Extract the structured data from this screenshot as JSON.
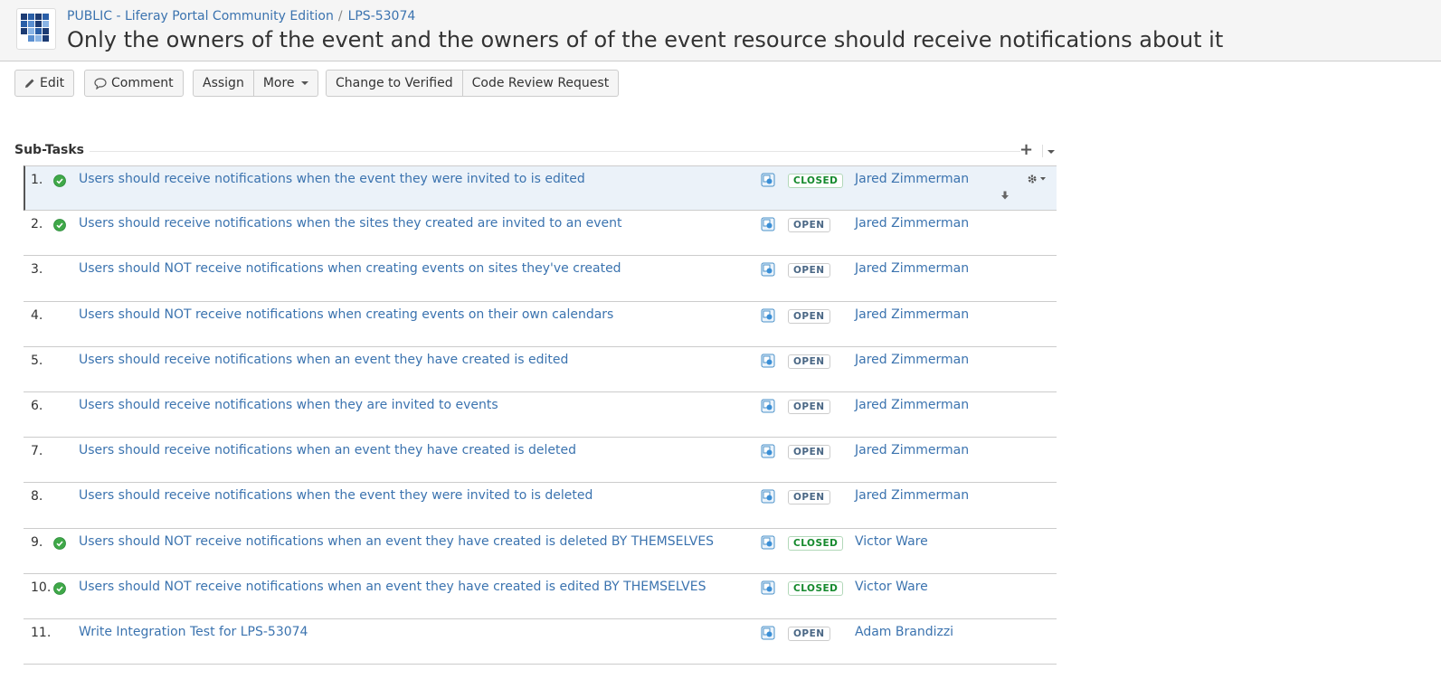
{
  "header": {
    "project_link": "PUBLIC - Liferay Portal Community Edition",
    "separator": "/",
    "issue_key": "LPS-53074",
    "summary": "Only the owners of the event and the owners of of the event resource should receive notifications about it"
  },
  "toolbar": {
    "edit": "Edit",
    "comment": "Comment",
    "assign": "Assign",
    "more": "More",
    "change_to_verified": "Change to Verified",
    "code_review_request": "Code Review Request"
  },
  "subtasks": {
    "title": "Sub-Tasks",
    "items": [
      {
        "num": "1.",
        "summary": "Users should receive notifications when the event they were invited to is edited",
        "status": "CLOSED",
        "assignee": "Jared Zimmerman",
        "resolved": true
      },
      {
        "num": "2.",
        "summary": "Users should receive notifications when the sites they created are invited to an event",
        "status": "OPEN",
        "assignee": "Jared Zimmerman",
        "resolved": true
      },
      {
        "num": "3.",
        "summary": "Users should NOT receive notifications when creating events on sites they've created",
        "status": "OPEN",
        "assignee": "Jared Zimmerman",
        "resolved": false
      },
      {
        "num": "4.",
        "summary": "Users should NOT receive notifications when creating events on their own calendars",
        "status": "OPEN",
        "assignee": "Jared Zimmerman",
        "resolved": false
      },
      {
        "num": "5.",
        "summary": "Users should receive notifications when an event they have created is edited",
        "status": "OPEN",
        "assignee": "Jared Zimmerman",
        "resolved": false
      },
      {
        "num": "6.",
        "summary": "Users should receive notifications when they are invited to events",
        "status": "OPEN",
        "assignee": "Jared Zimmerman",
        "resolved": false
      },
      {
        "num": "7.",
        "summary": "Users should receive notifications when an event they have created is deleted",
        "status": "OPEN",
        "assignee": "Jared Zimmerman",
        "resolved": false
      },
      {
        "num": "8.",
        "summary": "Users should receive notifications when the event they were invited to is deleted",
        "status": "OPEN",
        "assignee": "Jared Zimmerman",
        "resolved": false
      },
      {
        "num": "9.",
        "summary": "Users should NOT receive notifications when an event they have created is deleted BY THEMSELVES",
        "status": "CLOSED",
        "assignee": "Victor Ware",
        "resolved": true
      },
      {
        "num": "10.",
        "summary": "Users should NOT receive notifications when an event they have created is edited BY THEMSELVES",
        "status": "CLOSED",
        "assignee": "Victor Ware",
        "resolved": true
      },
      {
        "num": "11.",
        "summary": "Write Integration Test for LPS-53074",
        "status": "OPEN",
        "assignee": "Adam Brandizzi",
        "resolved": false
      }
    ]
  },
  "colors": {
    "link": "#3b73af",
    "closed_status": "#14892c",
    "open_status": "#4a6785",
    "selected_row": "#ebf2f9",
    "resolved_check": "#3fa848"
  },
  "icons": {
    "project_avatar": "liferay-logo-icon",
    "edit": "pencil-icon",
    "comment": "speech-bubble-icon",
    "resolved": "check-circle-icon",
    "issue_type": "subtask-type-icon",
    "row_actions": "gear-icon",
    "add": "plus-icon",
    "move_down": "arrow-down-icon"
  }
}
